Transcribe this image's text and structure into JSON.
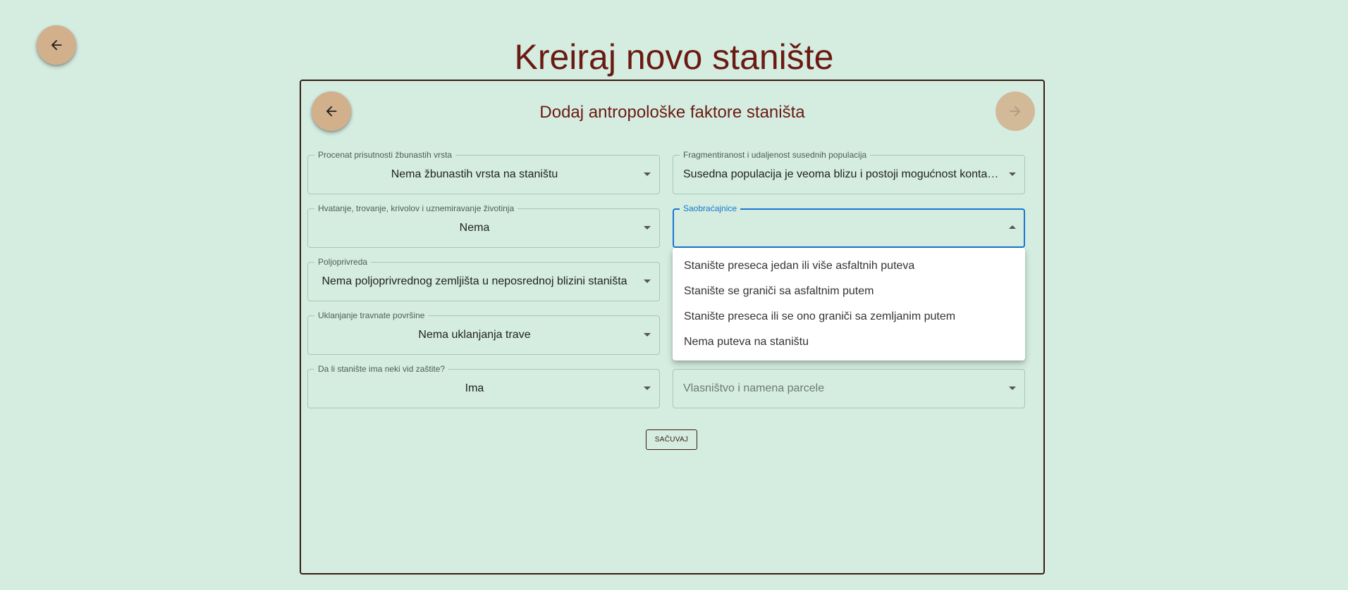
{
  "page": {
    "title": "Kreiraj novo stanište"
  },
  "card": {
    "subtitle": "Dodaj antropološke faktore staništa"
  },
  "icons": {
    "back": "arrow-left-icon",
    "next": "arrow-right-icon",
    "dropdown": "caret-down-icon"
  },
  "colors": {
    "background": "#d4ede0",
    "accent": "#d2b08c",
    "title": "#6b1a12",
    "focus": "#1976d2"
  },
  "fields": {
    "shrubs": {
      "label": "Procenat prisutnosti žbunastih vrsta",
      "value": "Nema žbunastih vrsta na staništu"
    },
    "fragmentation": {
      "label": "Fragmentiranost i udaljenost susednih populacija",
      "value": "Susedna populacija je veoma blizu i postoji mogućnost kontakta"
    },
    "hunting": {
      "label": "Hvatanje, trovanje, krivolov i uznemiravanje životinja",
      "value": "Nema"
    },
    "roads": {
      "label": "Saobraćajnice",
      "value": ""
    },
    "agriculture": {
      "label": "Poljoprivreda",
      "value": "Nema poljoprivrednog zemljišta u neposrednoj blizini staništa"
    },
    "grass": {
      "label": "Uklanjanje travnate površine",
      "value": "Nema uklanjanja trave"
    },
    "protection": {
      "label": "Da li stanište ima neki vid zaštite?",
      "value": "Ima"
    },
    "ownership": {
      "placeholder": "Vlasništvo i namena parcele"
    }
  },
  "dropdown": {
    "options": [
      "Stanište preseca jedan ili više asfaltnih puteva",
      "Stanište se graniči sa asfaltnim putem",
      "Stanište preseca ili se ono graniči sa zemljanim putem",
      "Nema puteva na staništu"
    ]
  },
  "actions": {
    "save_label": "SAČUVAJ"
  }
}
